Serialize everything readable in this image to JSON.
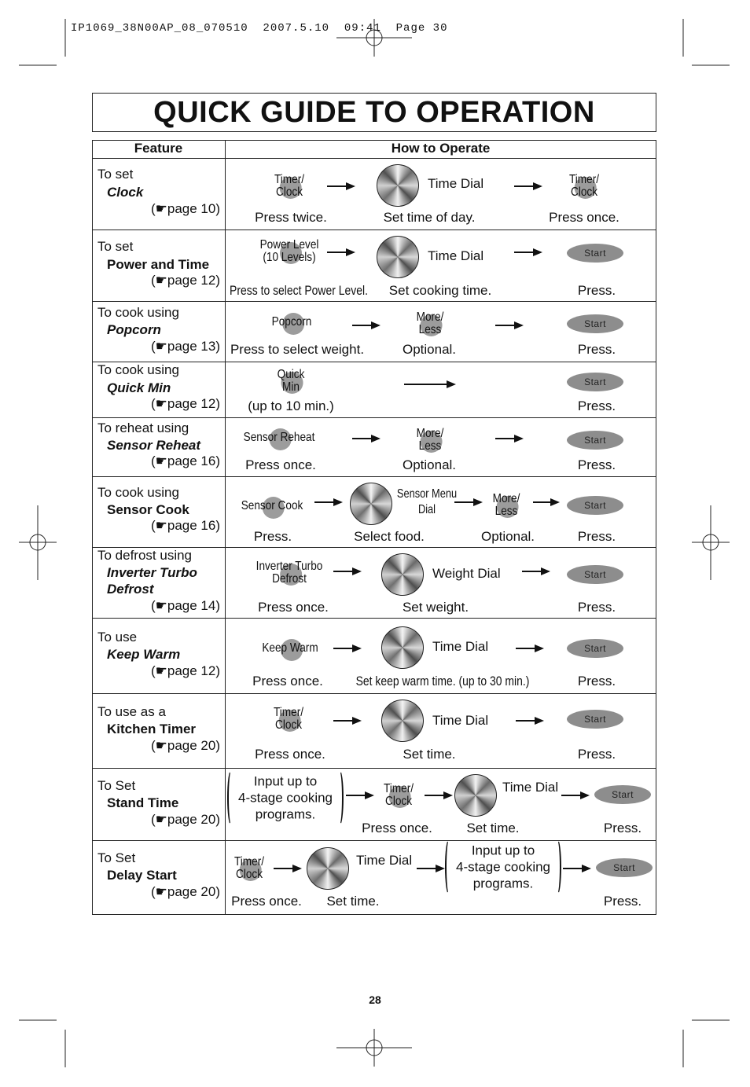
{
  "slug": "IP1069_38N00AP_08_070510  2007.5.10  09:41  Page 30",
  "title": "QUICK GUIDE TO OPERATION",
  "headers": {
    "feature": "Feature",
    "how": "How to Operate"
  },
  "page_number": "28",
  "page_ref_icon": "pointing-hand-icon",
  "rows": [
    {
      "feature": {
        "prefix": "To set",
        "name": "Clock",
        "italic": true,
        "page": "(☛page 10)"
      },
      "steps": [
        {
          "type": "button",
          "label": "Timer/\nClock"
        },
        {
          "type": "arrow"
        },
        {
          "type": "dial"
        },
        {
          "type": "dial-label",
          "label": "Time Dial"
        },
        {
          "type": "arrow"
        },
        {
          "type": "button",
          "label": "Timer/\nClock"
        }
      ],
      "captions": [
        "Press twice.",
        "Set time of day.",
        "Press once."
      ]
    },
    {
      "feature": {
        "prefix": "To set",
        "name": "Power and Time",
        "italic": false,
        "page": "(☛page 12)"
      },
      "steps": [
        {
          "type": "button",
          "label": "Power Level\n(10 Levels)"
        },
        {
          "type": "arrow"
        },
        {
          "type": "dial"
        },
        {
          "type": "dial-label",
          "label": "Time Dial"
        },
        {
          "type": "arrow"
        },
        {
          "type": "start",
          "label": "Start"
        }
      ],
      "captions": [
        "Press to select Power Level.",
        "Set cooking time.",
        "Press."
      ]
    },
    {
      "feature": {
        "prefix": "To cook using",
        "name": "Popcorn",
        "italic": true,
        "page": "(☛page 13)"
      },
      "steps": [
        {
          "type": "button",
          "label": "Popcorn"
        },
        {
          "type": "arrow"
        },
        {
          "type": "button",
          "label": "More/\nLess"
        },
        {
          "type": "arrow"
        },
        {
          "type": "start",
          "label": "Start"
        }
      ],
      "captions": [
        "Press to select weight.",
        "Optional.",
        "Press."
      ]
    },
    {
      "feature": {
        "prefix": "To cook using",
        "name": "Quick Min",
        "italic": true,
        "page": "(☛page 12)"
      },
      "steps": [
        {
          "type": "button",
          "label": "Quick\nMin"
        },
        {
          "type": "arrow"
        },
        {
          "type": "start",
          "label": "Start"
        }
      ],
      "captions": [
        "(up to 10 min.)",
        "Press."
      ]
    },
    {
      "feature": {
        "prefix": "To reheat using",
        "name": "Sensor Reheat",
        "italic": true,
        "page": "(☛page 16)"
      },
      "steps": [
        {
          "type": "button",
          "label": "Sensor Reheat"
        },
        {
          "type": "arrow"
        },
        {
          "type": "button",
          "label": "More/\nLess"
        },
        {
          "type": "arrow"
        },
        {
          "type": "start",
          "label": "Start"
        }
      ],
      "captions": [
        "Press once.",
        "Optional.",
        "Press."
      ]
    },
    {
      "feature": {
        "prefix": "To cook using",
        "name": "Sensor Cook",
        "italic": false,
        "page": "(☛page 16)"
      },
      "steps": [
        {
          "type": "button",
          "label": "Sensor Cook"
        },
        {
          "type": "arrow"
        },
        {
          "type": "dial"
        },
        {
          "type": "dial-label",
          "label": "Sensor Menu\nDial"
        },
        {
          "type": "arrow"
        },
        {
          "type": "button",
          "label": "More/\nLess"
        },
        {
          "type": "arrow"
        },
        {
          "type": "start",
          "label": "Start"
        }
      ],
      "captions": [
        "Press.",
        "Select food.",
        "Optional.",
        "Press."
      ]
    },
    {
      "feature": {
        "prefix": "To defrost using",
        "name": "Inverter Turbo\nDefrost",
        "italic": true,
        "page": "(☛page 14)"
      },
      "steps": [
        {
          "type": "button",
          "label": "Inverter Turbo\nDefrost"
        },
        {
          "type": "arrow"
        },
        {
          "type": "dial"
        },
        {
          "type": "dial-label",
          "label": "Weight Dial"
        },
        {
          "type": "arrow"
        },
        {
          "type": "start",
          "label": "Start"
        }
      ],
      "captions": [
        "Press once.",
        "Set weight.",
        "Press."
      ]
    },
    {
      "feature": {
        "prefix": "To use",
        "name": "Keep Warm",
        "italic": true,
        "page": "(☛page 12)"
      },
      "steps": [
        {
          "type": "button",
          "label": "Keep Warm"
        },
        {
          "type": "arrow"
        },
        {
          "type": "dial"
        },
        {
          "type": "dial-label",
          "label": "Time Dial"
        },
        {
          "type": "arrow"
        },
        {
          "type": "start",
          "label": "Start"
        }
      ],
      "captions": [
        "Press once.",
        "Set keep warm time. (up to 30 min.)",
        "Press."
      ]
    },
    {
      "feature": {
        "prefix": "To use as a",
        "name": "Kitchen Timer",
        "italic": false,
        "page": "(☛page 20)"
      },
      "steps": [
        {
          "type": "button",
          "label": "Timer/\nClock"
        },
        {
          "type": "arrow"
        },
        {
          "type": "dial"
        },
        {
          "type": "dial-label",
          "label": "Time Dial"
        },
        {
          "type": "arrow"
        },
        {
          "type": "start",
          "label": "Start"
        }
      ],
      "captions": [
        "Press once.",
        "Set time.",
        "Press."
      ]
    },
    {
      "feature": {
        "prefix": "To Set",
        "name": "Stand Time",
        "italic": false,
        "page": "(☛page 20)"
      },
      "steps": [
        {
          "type": "bracket",
          "label": "Input up to\n4-stage cooking\nprograms."
        },
        {
          "type": "arrow"
        },
        {
          "type": "button",
          "label": "Timer/\nClock"
        },
        {
          "type": "arrow"
        },
        {
          "type": "dial"
        },
        {
          "type": "dial-label",
          "label": "Time Dial"
        },
        {
          "type": "arrow"
        },
        {
          "type": "start",
          "label": "Start"
        }
      ],
      "captions": [
        "Press once.",
        "Set time.",
        "Press."
      ]
    },
    {
      "feature": {
        "prefix": "To Set",
        "name": "Delay Start",
        "italic": false,
        "page": "(☛page 20)"
      },
      "steps": [
        {
          "type": "button",
          "label": "Timer/\nClock"
        },
        {
          "type": "arrow"
        },
        {
          "type": "dial"
        },
        {
          "type": "dial-label",
          "label": "Time Dial"
        },
        {
          "type": "arrow"
        },
        {
          "type": "bracket",
          "label": "Input up to\n4-stage cooking\nprograms."
        },
        {
          "type": "arrow"
        },
        {
          "type": "start",
          "label": "Start"
        }
      ],
      "captions": [
        "Press once.",
        "Set time.",
        "Press."
      ]
    }
  ]
}
